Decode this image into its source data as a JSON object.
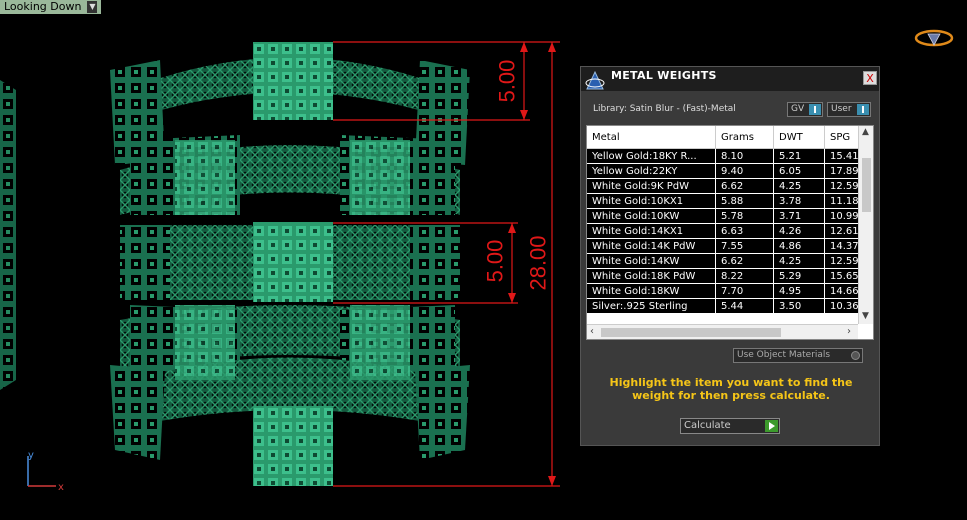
{
  "viewport": {
    "view_name": "Looking Down",
    "dimensions": {
      "total": "28.00",
      "band_top": "5.00",
      "band_middle": "5.00"
    },
    "axis": {
      "y": "y",
      "x": "x"
    }
  },
  "panel": {
    "title": "METAL WEIGHTS",
    "close": "X",
    "library": "Library: Satin Blur - (Fast)-Metal",
    "toggle_gv": "GV",
    "toggle_user": "User",
    "columns": [
      "Metal",
      "Grams",
      "DWT",
      "SPG"
    ],
    "rows": [
      [
        "Yellow Gold:18KY R...",
        "8.10",
        "5.21",
        "15.41"
      ],
      [
        "Yellow Gold:22KY",
        "9.40",
        "6.05",
        "17.89"
      ],
      [
        "White Gold:9K PdW",
        "6.62",
        "4.25",
        "12.59"
      ],
      [
        "White Gold:10KX1",
        "5.88",
        "3.78",
        "11.18"
      ],
      [
        "White Gold:10KW",
        "5.78",
        "3.71",
        "10.99"
      ],
      [
        "White Gold:14KX1",
        "6.63",
        "4.26",
        "12.61"
      ],
      [
        "White Gold:14K PdW",
        "7.55",
        "4.86",
        "14.37"
      ],
      [
        "White Gold:14KW",
        "6.62",
        "4.25",
        "12.59"
      ],
      [
        "White Gold:18K PdW",
        "8.22",
        "5.29",
        "15.65"
      ],
      [
        "White Gold:18KW",
        "7.70",
        "4.95",
        "14.66"
      ],
      [
        "Silver:.925 Sterling",
        "5.44",
        "3.50",
        "10.36"
      ]
    ],
    "use_object_materials": "Use Object Materials",
    "hint": "Highlight the item you want to find the weight for then press calculate.",
    "calculate": "Calculate"
  },
  "colors": {
    "metal": "#1f7a55",
    "dimension": "#e01818",
    "hint": "#f5c518"
  }
}
